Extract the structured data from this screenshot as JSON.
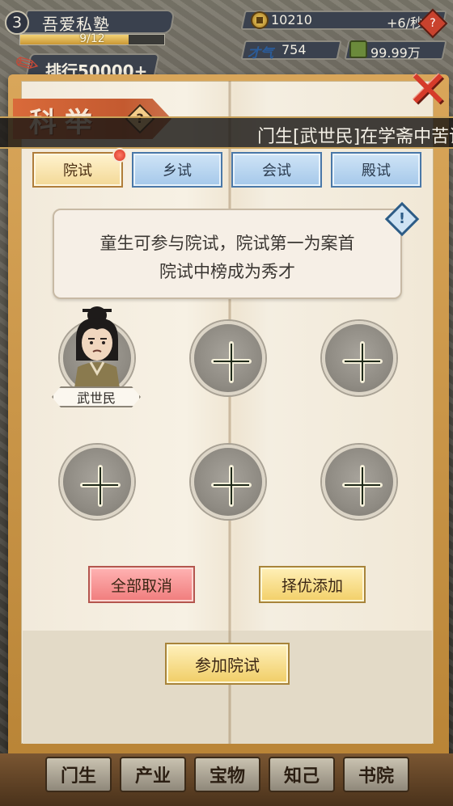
{
  "hud": {
    "level": "3",
    "name": "吾爱私塾",
    "exp_text": "9/12",
    "exp_progress": 0.75,
    "rank_text": "排行50000+",
    "coins": "10210",
    "coin_rate": "+6/秒",
    "talent_label": "才气",
    "talent_value": "754",
    "money": "99.99万",
    "help_icon": "question-icon"
  },
  "panel": {
    "title": "科举",
    "ticker": "门生[武世民]在学斋中苦读",
    "close_icon": "close-icon"
  },
  "tabs": [
    {
      "label": "院试",
      "active": true
    },
    {
      "label": "乡试",
      "active": false
    },
    {
      "label": "会试",
      "active": false
    },
    {
      "label": "殿试",
      "active": false
    }
  ],
  "info": {
    "line1": "童生可参与院试，院试第一为案首",
    "line2": "院试中榜成为秀才"
  },
  "slots": [
    {
      "filled": true,
      "student_name": "武世民"
    },
    {
      "filled": false
    },
    {
      "filled": false
    },
    {
      "filled": false
    },
    {
      "filled": false
    },
    {
      "filled": false
    }
  ],
  "actions": {
    "cancel_all": "全部取消",
    "auto_add": "择优添加",
    "join_exam": "参加院试"
  },
  "bottom_nav": [
    "门生",
    "产业",
    "宝物",
    "知己",
    "书院"
  ],
  "colors": {
    "accent_red": "#d63b2a",
    "tab_active": "#f3d896",
    "tab_inactive": "#a5c8ea",
    "cancel_button": "#f07c7c",
    "gold_button": "#f2cf67"
  }
}
